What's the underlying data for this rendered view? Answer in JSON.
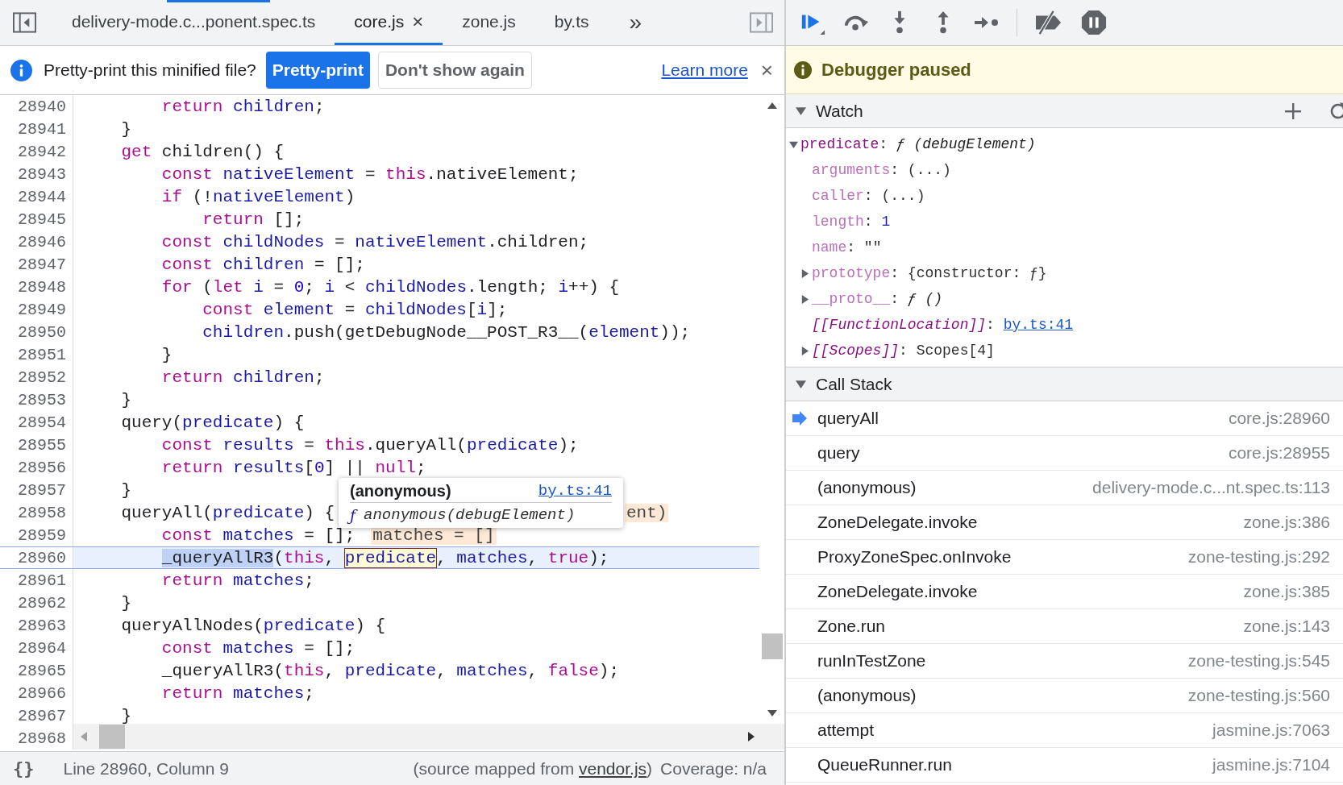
{
  "tabs": [
    {
      "label": "delivery-mode.c...ponent.spec.ts",
      "selected": false
    },
    {
      "label": "core.js",
      "selected": true,
      "close": "×"
    },
    {
      "label": "zone.js",
      "selected": false
    },
    {
      "label": "by.ts",
      "selected": false
    }
  ],
  "more_tabs": "»",
  "infobar": {
    "message": "Pretty-print this minified file?",
    "primary_button": "Pretty-print",
    "secondary_button": "Don't show again",
    "link": "Learn more",
    "close": "×"
  },
  "editor": {
    "lines": [
      {
        "number": "28940",
        "current": false,
        "tokens": [
          {
            "kind": "keyword",
            "text": "        return"
          },
          {
            "kind": "variable",
            "text": " children"
          },
          {
            "kind": "plain",
            "text": ";"
          }
        ]
      },
      {
        "number": "28941",
        "current": false,
        "tokens": [
          {
            "kind": "plain",
            "text": "    }"
          }
        ]
      },
      {
        "number": "28942",
        "current": false,
        "tokens": [
          {
            "kind": "keyword",
            "text": "    get"
          },
          {
            "kind": "plain",
            "text": " children() {"
          }
        ]
      },
      {
        "number": "28943",
        "current": false,
        "tokens": [
          {
            "kind": "keyword",
            "text": "        const"
          },
          {
            "kind": "variable",
            "text": " nativeElement"
          },
          {
            "kind": "plain",
            "text": " = "
          },
          {
            "kind": "keyword",
            "text": "this"
          },
          {
            "kind": "plain",
            "text": ".nativeElement;"
          }
        ]
      },
      {
        "number": "28944",
        "current": false,
        "tokens": [
          {
            "kind": "keyword",
            "text": "        if"
          },
          {
            "kind": "plain",
            "text": " (!"
          },
          {
            "kind": "variable",
            "text": "nativeElement"
          },
          {
            "kind": "plain",
            "text": ")"
          }
        ]
      },
      {
        "number": "28945",
        "current": false,
        "tokens": [
          {
            "kind": "keyword",
            "text": "            return"
          },
          {
            "kind": "plain",
            "text": " [];"
          }
        ]
      },
      {
        "number": "28946",
        "current": false,
        "tokens": [
          {
            "kind": "keyword",
            "text": "        const"
          },
          {
            "kind": "variable",
            "text": " childNodes"
          },
          {
            "kind": "plain",
            "text": " = "
          },
          {
            "kind": "variable",
            "text": "nativeElement"
          },
          {
            "kind": "plain",
            "text": ".children;"
          }
        ]
      },
      {
        "number": "28947",
        "current": false,
        "tokens": [
          {
            "kind": "keyword",
            "text": "        const"
          },
          {
            "kind": "variable",
            "text": " children"
          },
          {
            "kind": "plain",
            "text": " = [];"
          }
        ]
      },
      {
        "number": "28948",
        "current": false,
        "tokens": [
          {
            "kind": "keyword",
            "text": "        for"
          },
          {
            "kind": "plain",
            "text": " ("
          },
          {
            "kind": "keyword",
            "text": "let"
          },
          {
            "kind": "variable",
            "text": " i"
          },
          {
            "kind": "plain",
            "text": " = "
          },
          {
            "kind": "number",
            "text": "0"
          },
          {
            "kind": "plain",
            "text": "; "
          },
          {
            "kind": "variable",
            "text": "i"
          },
          {
            "kind": "plain",
            "text": " < "
          },
          {
            "kind": "variable",
            "text": "childNodes"
          },
          {
            "kind": "plain",
            "text": ".length; "
          },
          {
            "kind": "variable",
            "text": "i"
          },
          {
            "kind": "plain",
            "text": "++) {"
          }
        ]
      },
      {
        "number": "28949",
        "current": false,
        "tokens": [
          {
            "kind": "keyword",
            "text": "            const"
          },
          {
            "kind": "variable",
            "text": " element"
          },
          {
            "kind": "plain",
            "text": " = "
          },
          {
            "kind": "variable",
            "text": "childNodes"
          },
          {
            "kind": "plain",
            "text": "["
          },
          {
            "kind": "variable",
            "text": "i"
          },
          {
            "kind": "plain",
            "text": "];"
          }
        ]
      },
      {
        "number": "28950",
        "current": false,
        "tokens": [
          {
            "kind": "variable",
            "text": "            children"
          },
          {
            "kind": "plain",
            "text": ".push(getDebugNode__POST_R3__("
          },
          {
            "kind": "variable",
            "text": "element"
          },
          {
            "kind": "plain",
            "text": "));"
          }
        ]
      },
      {
        "number": "28951",
        "current": false,
        "tokens": [
          {
            "kind": "plain",
            "text": "        }"
          }
        ]
      },
      {
        "number": "28952",
        "current": false,
        "tokens": [
          {
            "kind": "keyword",
            "text": "        return"
          },
          {
            "kind": "variable",
            "text": " children"
          },
          {
            "kind": "plain",
            "text": ";"
          }
        ]
      },
      {
        "number": "28953",
        "current": false,
        "tokens": [
          {
            "kind": "plain",
            "text": "    }"
          }
        ]
      },
      {
        "number": "28954",
        "current": false,
        "tokens": [
          {
            "kind": "plain",
            "text": "    query("
          },
          {
            "kind": "variable",
            "text": "predicate"
          },
          {
            "kind": "plain",
            "text": ") {"
          }
        ]
      },
      {
        "number": "28955",
        "current": false,
        "tokens": [
          {
            "kind": "keyword",
            "text": "        const"
          },
          {
            "kind": "variable",
            "text": " results"
          },
          {
            "kind": "plain",
            "text": " = "
          },
          {
            "kind": "keyword",
            "text": "this"
          },
          {
            "kind": "plain",
            "text": ".queryAll("
          },
          {
            "kind": "variable",
            "text": "predicate"
          },
          {
            "kind": "plain",
            "text": ");"
          }
        ]
      },
      {
        "number": "28956",
        "current": false,
        "tokens": [
          {
            "kind": "keyword",
            "text": "        return"
          },
          {
            "kind": "variable",
            "text": " results"
          },
          {
            "kind": "plain",
            "text": "["
          },
          {
            "kind": "number",
            "text": "0"
          },
          {
            "kind": "plain",
            "text": "] || "
          },
          {
            "kind": "keyword",
            "text": "null"
          },
          {
            "kind": "plain",
            "text": ";"
          }
        ]
      },
      {
        "number": "28957",
        "current": false,
        "tokens": [
          {
            "kind": "plain",
            "text": "    }"
          }
        ]
      },
      {
        "number": "28958",
        "current": false,
        "tokens": [
          {
            "kind": "plain",
            "text": "    queryAll("
          },
          {
            "kind": "variable",
            "text": "predicate"
          },
          {
            "kind": "plain",
            "text": ") {"
          }
        ],
        "inline_value": {
          "text": "ent)",
          "clipped": true
        }
      },
      {
        "number": "28959",
        "current": false,
        "tokens": [
          {
            "kind": "keyword",
            "text": "        const"
          },
          {
            "kind": "variable",
            "text": " matches"
          },
          {
            "kind": "plain",
            "text": " = [];"
          }
        ],
        "inline_value": {
          "text": "matches = []",
          "clipped": false
        }
      },
      {
        "number": "28960",
        "current": true,
        "tokens": [
          {
            "kind": "paused",
            "text": "        _queryAllR3"
          },
          {
            "kind": "plain",
            "text": "("
          },
          {
            "kind": "keyword",
            "text": "this"
          },
          {
            "kind": "plain",
            "text": ", "
          },
          {
            "kind": "hovered",
            "text": "predicate"
          },
          {
            "kind": "plain",
            "text": ", "
          },
          {
            "kind": "variable",
            "text": "matches"
          },
          {
            "kind": "plain",
            "text": ", "
          },
          {
            "kind": "keyword",
            "text": "true"
          },
          {
            "kind": "plain",
            "text": ");"
          }
        ]
      },
      {
        "number": "28961",
        "current": false,
        "tokens": [
          {
            "kind": "keyword",
            "text": "        return"
          },
          {
            "kind": "variable",
            "text": " matches"
          },
          {
            "kind": "plain",
            "text": ";"
          }
        ]
      },
      {
        "number": "28962",
        "current": false,
        "tokens": [
          {
            "kind": "plain",
            "text": "    }"
          }
        ]
      },
      {
        "number": "28963",
        "current": false,
        "tokens": [
          {
            "kind": "plain",
            "text": "    queryAllNodes("
          },
          {
            "kind": "variable",
            "text": "predicate"
          },
          {
            "kind": "plain",
            "text": ") {"
          }
        ]
      },
      {
        "number": "28964",
        "current": false,
        "tokens": [
          {
            "kind": "keyword",
            "text": "        const"
          },
          {
            "kind": "variable",
            "text": " matches"
          },
          {
            "kind": "plain",
            "text": " = [];"
          }
        ]
      },
      {
        "number": "28965",
        "current": false,
        "tokens": [
          {
            "kind": "plain",
            "text": "        _queryAllR3("
          },
          {
            "kind": "keyword",
            "text": "this"
          },
          {
            "kind": "plain",
            "text": ", "
          },
          {
            "kind": "variable",
            "text": "predicate"
          },
          {
            "kind": "plain",
            "text": ", "
          },
          {
            "kind": "variable",
            "text": "matches"
          },
          {
            "kind": "plain",
            "text": ", "
          },
          {
            "kind": "keyword",
            "text": "false"
          },
          {
            "kind": "plain",
            "text": ");"
          }
        ]
      },
      {
        "number": "28966",
        "current": false,
        "tokens": [
          {
            "kind": "keyword",
            "text": "        return"
          },
          {
            "kind": "variable",
            "text": " matches"
          },
          {
            "kind": "plain",
            "text": ";"
          }
        ]
      },
      {
        "number": "28967",
        "current": false,
        "tokens": [
          {
            "kind": "plain",
            "text": "    }"
          }
        ]
      },
      {
        "number": "28968",
        "current": false
      }
    ],
    "tooltip": {
      "title": "(anonymous)",
      "link": "by.ts:41",
      "symbol": "ƒ",
      "signature": "anonymous(debugElement)"
    }
  },
  "status_bar": {
    "format_button": "{}",
    "position": "Line 28960, Column 9",
    "source_prefix": "(source mapped from ",
    "source_link": "vendor.js",
    "source_suffix": ")",
    "coverage": "Coverage: n/a"
  },
  "paused_banner": {
    "text": "Debugger paused"
  },
  "watch": {
    "title": "Watch",
    "expanded": true,
    "items": [
      {
        "key": "predicate",
        "separator": ":",
        "value": "ƒ (debugElement)",
        "kind": "function",
        "dimmed": false,
        "internal": false,
        "expanded": true,
        "children": [
          {
            "key": "arguments",
            "separator": ":",
            "value": "(...)",
            "kind": "plain",
            "dimmed": true,
            "internal": false
          },
          {
            "key": "caller",
            "separator": ":",
            "value": "(...)",
            "kind": "plain",
            "dimmed": true,
            "internal": false
          },
          {
            "key": "length",
            "separator": ":",
            "value": "1",
            "kind": "number",
            "dimmed": true,
            "internal": false
          },
          {
            "key": "name",
            "separator": ":",
            "value": "\"\"",
            "kind": "plain",
            "dimmed": true,
            "internal": false
          },
          {
            "key": "prototype",
            "separator": ":",
            "value": "{constructor: ƒ}",
            "kind": "plain",
            "dimmed": true,
            "internal": false,
            "expanded": false
          },
          {
            "key": "__proto__",
            "separator": ":",
            "value": "ƒ ()",
            "kind": "function",
            "dimmed": true,
            "internal": false,
            "expanded": false
          },
          {
            "key": "[[FunctionLocation]]",
            "separator": ":",
            "value": "by.ts:41",
            "kind": "link",
            "dimmed": false,
            "internal": true
          },
          {
            "key": "[[Scopes]]",
            "separator": ":",
            "value": "Scopes[4]",
            "kind": "plain",
            "dimmed": false,
            "internal": true,
            "expanded": false
          }
        ]
      }
    ]
  },
  "call_stack": {
    "title": "Call Stack",
    "expanded": true,
    "frames": [
      {
        "name": "queryAll",
        "location": "core.js:28960",
        "selected": true
      },
      {
        "name": "query",
        "location": "core.js:28955",
        "selected": false
      },
      {
        "name": "(anonymous)",
        "location": "delivery-mode.c...nt.spec.ts:113",
        "selected": false
      },
      {
        "name": "ZoneDelegate.invoke",
        "location": "zone.js:386",
        "selected": false
      },
      {
        "name": "ProxyZoneSpec.onInvoke",
        "location": "zone-testing.js:292",
        "selected": false
      },
      {
        "name": "ZoneDelegate.invoke",
        "location": "zone.js:385",
        "selected": false
      },
      {
        "name": "Zone.run",
        "location": "zone.js:143",
        "selected": false
      },
      {
        "name": "runInTestZone",
        "location": "zone-testing.js:545",
        "selected": false
      },
      {
        "name": "(anonymous)",
        "location": "zone-testing.js:560",
        "selected": false
      },
      {
        "name": "attempt",
        "location": "jasmine.js:7063",
        "selected": false
      },
      {
        "name": "QueueRunner.run",
        "location": "jasmine.js:7104",
        "selected": false
      }
    ]
  }
}
